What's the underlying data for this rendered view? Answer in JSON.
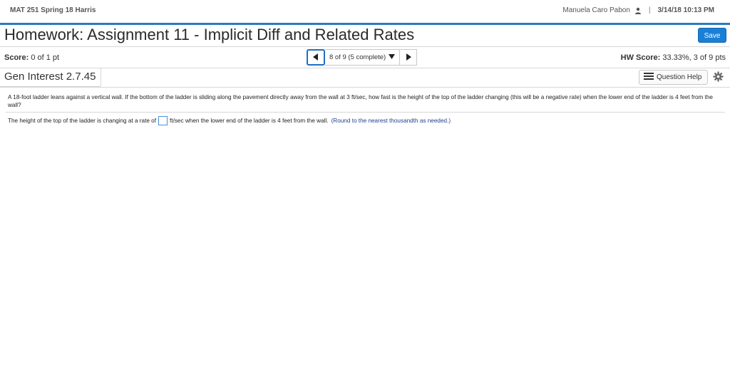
{
  "header": {
    "course": "MAT 251 Spring 18 Harris",
    "user_name": "Manuela Caro Pabon",
    "separator": "|",
    "datetime": "3/14/18 10:13 PM"
  },
  "homework": {
    "title": "Homework: Assignment 11 - Implicit Diff and Related Rates",
    "save_label": "Save"
  },
  "score": {
    "label": "Score:",
    "value": "0 of 1 pt"
  },
  "navigation": {
    "position_label": "8 of 9 (5 complete)"
  },
  "hw_score": {
    "label": "HW Score:",
    "value": "33.33%, 3 of 9 pts"
  },
  "section": {
    "title": "Gen Interest 2.7.45",
    "question_help_label": "Question Help"
  },
  "question": {
    "text": "A 18-foot ladder leans against a vertical wall.  If the bottom of the ladder is sliding along the pavement directly away from the wall at 3 ft/sec, how fast is the height of the top of the ladder changing (this will be a negative rate) when the lower end of the ladder is 4 feet from the wall?",
    "answer_prefix": "The height of the top of the ladder is changing at a rate of",
    "answer_suffix": "ft/sec when the  lower end of the ladder is 4 feet from the wall.",
    "answer_hint": "(Round to the nearest thousandth as needed.)",
    "answer_value": ""
  },
  "icons": {
    "user": "user-icon",
    "prev": "arrow-left-icon",
    "dropdown": "caret-down-icon",
    "next": "arrow-right-icon",
    "help": "list-icon",
    "settings": "gear-icon"
  },
  "colors": {
    "accent": "#2b7bbf",
    "save_button": "#1a7fd6",
    "hint_text": "#1f3f8f"
  }
}
